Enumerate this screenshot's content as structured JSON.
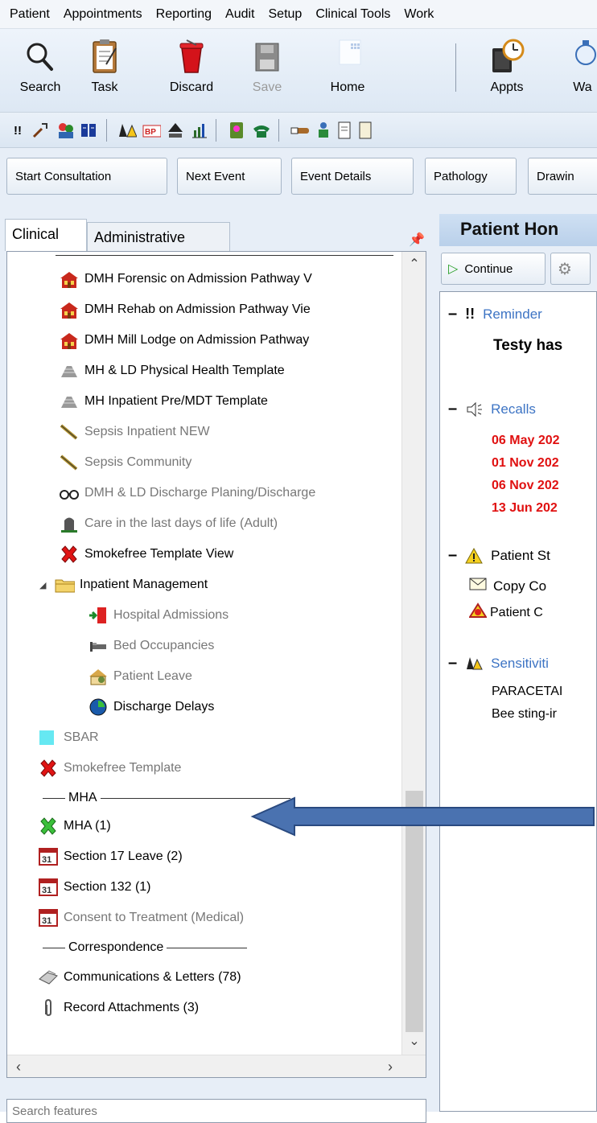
{
  "menu": [
    "Patient",
    "Appointments",
    "Reporting",
    "Audit",
    "Setup",
    "Clinical Tools",
    "Work"
  ],
  "toolbar": {
    "buttons": [
      {
        "label": "Search",
        "icon": "magnifier-icon"
      },
      {
        "label": "Task",
        "icon": "clipboard-icon"
      },
      {
        "label": "Discard",
        "icon": "discard-bin-icon"
      },
      {
        "label": "Save",
        "icon": "floppy-disk-icon",
        "disabled": true
      },
      {
        "label": "Home",
        "icon": "home-grid-icon"
      },
      {
        "label": "Appts",
        "icon": "appointment-clock-icon"
      },
      {
        "label": "Wa",
        "icon": "waiting-icon"
      }
    ]
  },
  "action_buttons": [
    "Start Consultation",
    "Next Event",
    "Event Details",
    "Pathology",
    "Drawin"
  ],
  "left_tabs": {
    "active": "Clinical",
    "inactive": "Administrative"
  },
  "tree": {
    "items": [
      {
        "label": "DMH Forensic on Admission Pathway V",
        "icon": "house-red-icon",
        "grey": false
      },
      {
        "label": "DMH Rehab on Admission Pathway Vie",
        "icon": "house-red-icon",
        "grey": false
      },
      {
        "label": "DMH Mill Lodge on Admission Pathway",
        "icon": "house-red-icon",
        "grey": false
      },
      {
        "label": "MH & LD Physical Health Template",
        "icon": "template-grey-icon",
        "grey": false
      },
      {
        "label": "MH Inpatient Pre/MDT Template",
        "icon": "template-grey-icon",
        "grey": false
      },
      {
        "label": "Sepsis Inpatient NEW",
        "icon": "ruler-icon",
        "grey": true
      },
      {
        "label": "Sepsis Community",
        "icon": "ruler-icon",
        "grey": true
      },
      {
        "label": "DMH & LD Discharge Planing/Discharge",
        "icon": "glasses-icon",
        "grey": true
      },
      {
        "label": "Care in the last days of life (Adult)",
        "icon": "gravestone-icon",
        "grey": true
      },
      {
        "label": "Smokefree Template View",
        "icon": "red-cross-icon",
        "grey": false
      }
    ],
    "folder": {
      "label": "Inpatient Management",
      "icon": "folder-icon"
    },
    "sub_items": [
      {
        "label": "Hospital Admissions",
        "icon": "door-arrow-icon",
        "grey": true
      },
      {
        "label": "Bed Occupancies",
        "icon": "bed-icon",
        "grey": true
      },
      {
        "label": "Patient Leave",
        "icon": "house-leave-icon",
        "grey": true
      },
      {
        "label": "Discharge Delays",
        "icon": "clock-icon",
        "grey": false
      }
    ],
    "after_items": [
      {
        "label": "SBAR",
        "icon": "cyan-square-icon",
        "grey": true
      },
      {
        "label": "Smokefree Template",
        "icon": "red-cross-icon",
        "grey": true
      }
    ],
    "mha_header": "MHA",
    "mha_items": [
      {
        "label": "MHA (1)",
        "icon": "green-cross-icon",
        "grey": false
      },
      {
        "label": "Section 17 Leave (2)",
        "icon": "calendar-icon",
        "grey": false
      },
      {
        "label": "Section 132 (1)",
        "icon": "calendar-icon",
        "grey": false
      },
      {
        "label": "Consent to Treatment (Medical)",
        "icon": "calendar-icon",
        "grey": true
      }
    ],
    "corr_header": "Correspondence",
    "corr_items": [
      {
        "label": "Communications & Letters (78)",
        "icon": "letters-icon",
        "grey": false
      },
      {
        "label": "Record Attachments (3)",
        "icon": "paperclip-icon",
        "grey": false
      }
    ]
  },
  "search_placeholder": "Search features",
  "right": {
    "title": "Patient Hon",
    "continue_label": "Continue",
    "reminders": {
      "title": "Reminder",
      "text": "Testy has"
    },
    "recalls": {
      "title": "Recalls",
      "dates": [
        "06 May 202",
        "01 Nov 202",
        "06 Nov 202",
        "13 Jun 202"
      ]
    },
    "status": {
      "title": "Patient St",
      "items": [
        "Copy Co",
        "Patient C"
      ]
    },
    "sensitivities": {
      "title": "Sensitiviti",
      "items": [
        "PARACETAI",
        "Bee sting-ir"
      ]
    }
  },
  "colors": {
    "recall_red": "#e01010",
    "link_blue": "#3d74c4",
    "arrow_blue": "#4a72b0"
  }
}
